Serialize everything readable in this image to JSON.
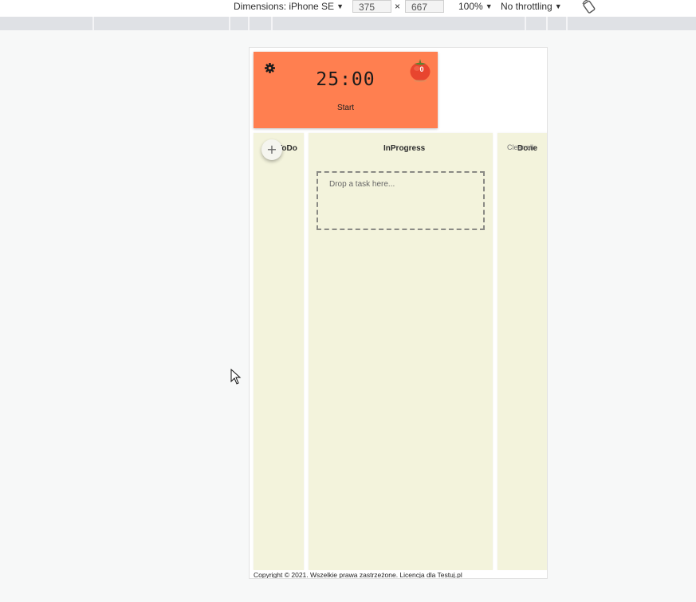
{
  "devtools": {
    "dimensions_label": "Dimensions: iPhone SE",
    "width_value": "375",
    "times": "×",
    "height_value": "667",
    "zoom": "100%",
    "throttling": "No throttling",
    "dropdown_arrow": "▼"
  },
  "app": {
    "timer": {
      "time": "25:00",
      "start_label": "Start",
      "pomodoro_count": "0",
      "colors": {
        "card": "#ff7f50",
        "tomato": "#e8452f"
      }
    },
    "columns": {
      "todo": {
        "title": "ToDo",
        "add_icon": "+"
      },
      "inprogress": {
        "title": "InProgress",
        "drop_placeholder": "Drop a task here..."
      },
      "done": {
        "title": "Done",
        "clear_label": "Clear all"
      }
    },
    "footer": "Copyright © 2021. Wszelkie prawa zastrzeżone. Licencja dla Testuj.pl"
  }
}
